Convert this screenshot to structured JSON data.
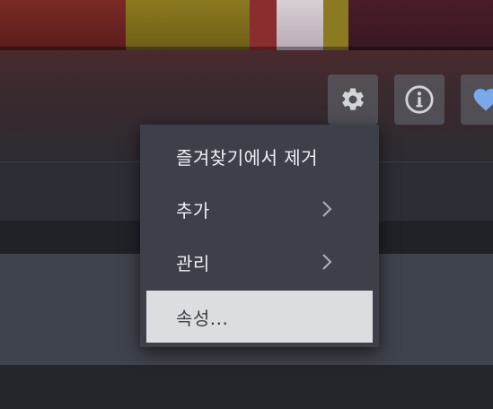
{
  "toolbar": {
    "buttons": [
      {
        "name": "settings",
        "icon": "gear-icon"
      },
      {
        "name": "info",
        "icon": "info-icon"
      },
      {
        "name": "favorite",
        "icon": "heart-icon"
      }
    ]
  },
  "context_menu": {
    "items": [
      {
        "label": "즐겨찾기에서 제거",
        "has_submenu": false
      },
      {
        "label": "추가",
        "has_submenu": true,
        "icon": "chevron-right-icon"
      },
      {
        "label": "관리",
        "has_submenu": true,
        "icon": "chevron-right-icon"
      },
      {
        "label": "속성...",
        "has_submenu": false,
        "highlighted": true
      }
    ]
  },
  "colors": {
    "menu_bg": "#3d4049",
    "menu_highlight": "#dcdde0",
    "heart": "#79a9ea",
    "icon": "#d2d4d8"
  }
}
